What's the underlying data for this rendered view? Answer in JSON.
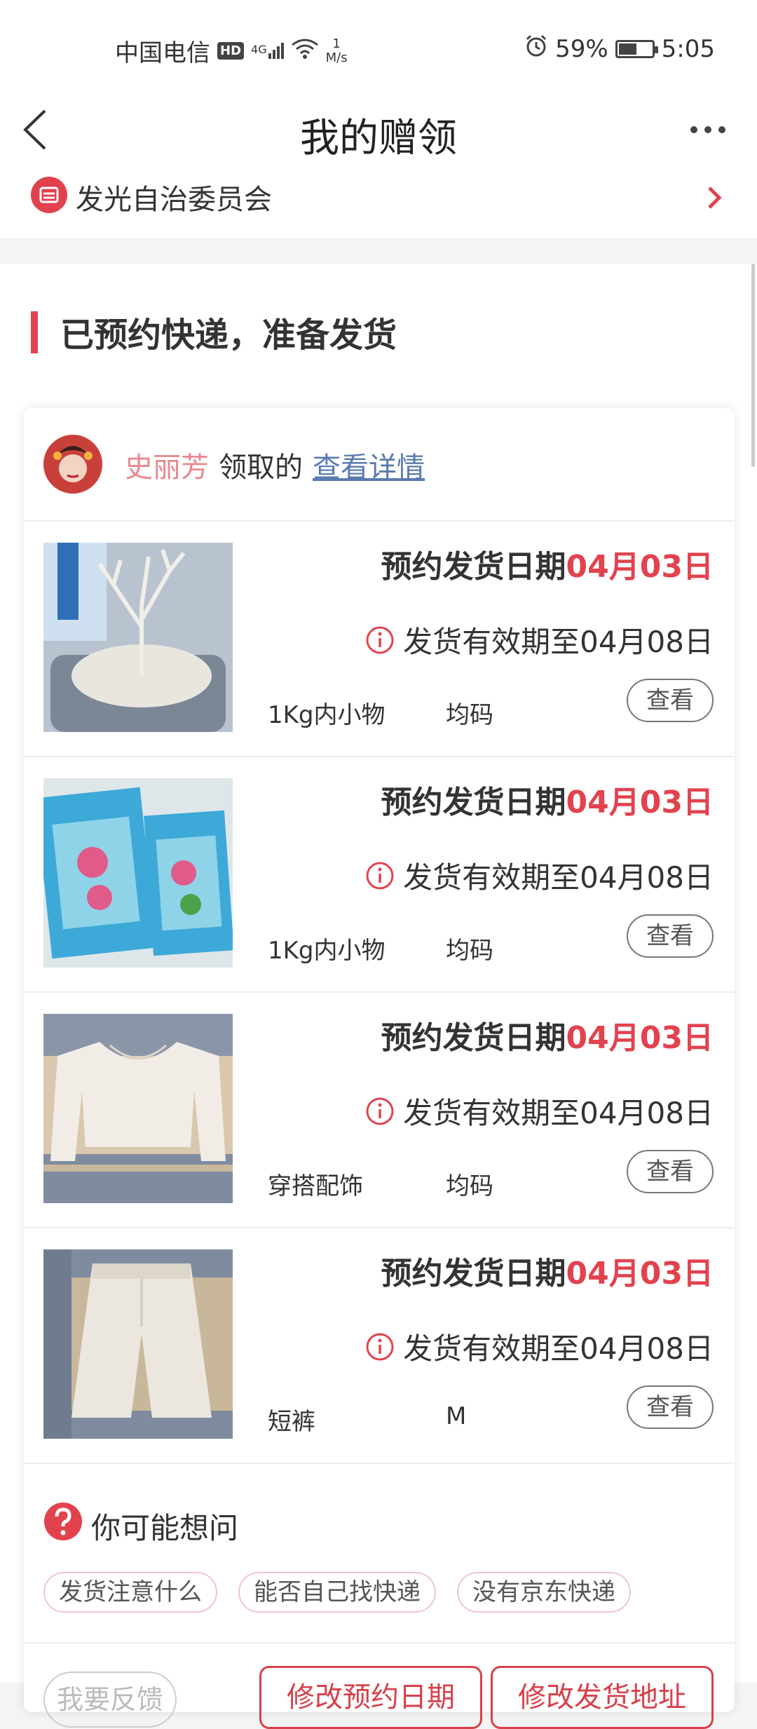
{
  "status_bar": {
    "carrier": "中国电信",
    "hd": "HD",
    "signal_label": "4G",
    "net_speed_value": "1",
    "net_speed_unit": "M/s",
    "battery": "59%",
    "battery_level": 0.59,
    "time": "5:05"
  },
  "nav": {
    "title": "我的赠领"
  },
  "community": {
    "name": "发光自治委员会"
  },
  "section": {
    "title": "已预约快递，准备发货"
  },
  "claim": {
    "claimer": "史丽芳",
    "text": "领取的",
    "link": "查看详情"
  },
  "items": [
    {
      "ship_label": "预约发货日期",
      "ship_date": "04月03日",
      "valid_text": "发货有效期至04月08日",
      "category": "1Kg内小物",
      "size": "均码",
      "button": "查看"
    },
    {
      "ship_label": "预约发货日期",
      "ship_date": "04月03日",
      "valid_text": "发货有效期至04月08日",
      "category": "1Kg内小物",
      "size": "均码",
      "button": "查看"
    },
    {
      "ship_label": "预约发货日期",
      "ship_date": "04月03日",
      "valid_text": "发货有效期至04月08日",
      "category": "穿搭配饰",
      "size": "均码",
      "button": "查看"
    },
    {
      "ship_label": "预约发货日期",
      "ship_date": "04月03日",
      "valid_text": "发货有效期至04月08日",
      "category": "短裤",
      "size": "M",
      "button": "查看"
    }
  ],
  "faq": {
    "title": "你可能想问",
    "tags": [
      "发货注意什么",
      "能否自己找快递",
      "没有京东快递"
    ]
  },
  "footer": {
    "feedback": "我要反馈",
    "change_date": "修改预约日期",
    "change_address": "修改发货地址"
  },
  "colors": {
    "accent": "#e2424e",
    "link": "#5a7bb0",
    "claimer": "#e8888f"
  }
}
